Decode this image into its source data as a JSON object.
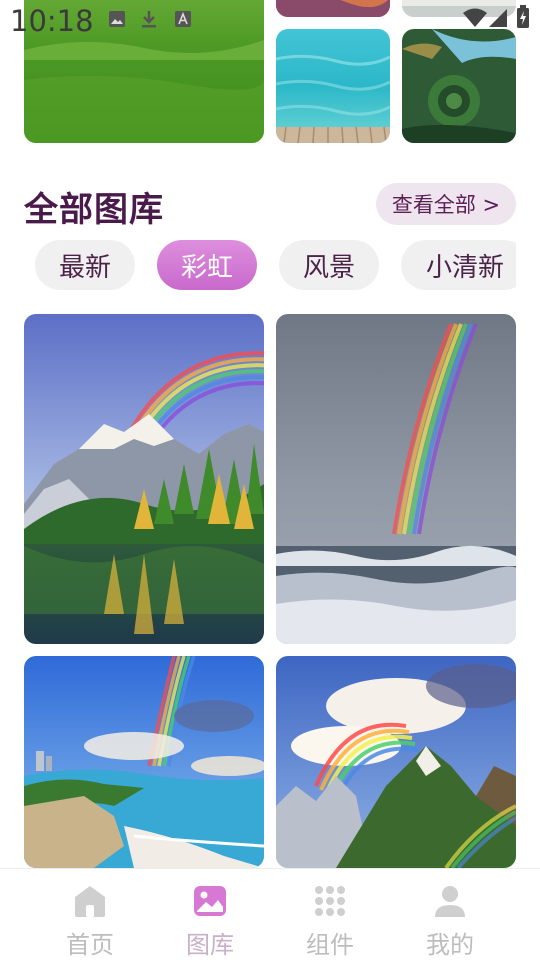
{
  "status_bar": {
    "time": "10:18",
    "icons": [
      "gallery-icon",
      "download-icon",
      "a-icon",
      "wifi-icon",
      "signal-icon",
      "battery-icon"
    ]
  },
  "gallery": {
    "title": "全部图库",
    "view_all_label": "查看全部 >",
    "categories": [
      {
        "label": "最新",
        "active": false
      },
      {
        "label": "彩虹",
        "active": true
      },
      {
        "label": "风景",
        "active": false
      },
      {
        "label": "小清新",
        "active": false
      }
    ],
    "images": [
      {
        "name": "rainbow-mountain-lake",
        "description": "Rainbow over snowy mountains and lake"
      },
      {
        "name": "rainbow-ocean-waves",
        "description": "Rainbow over stormy sea"
      },
      {
        "name": "rainbow-coast-cliffs",
        "description": "Rainbow over coastal cliffs and beach"
      },
      {
        "name": "rainbow-mountain-clouds",
        "description": "Rainbow over mountain peaks and clouds"
      }
    ]
  },
  "bottom_nav": {
    "items": [
      {
        "label": "首页",
        "icon": "home-icon",
        "active": false
      },
      {
        "label": "图库",
        "icon": "gallery-icon",
        "active": true
      },
      {
        "label": "组件",
        "icon": "grid-icon",
        "active": false
      },
      {
        "label": "我的",
        "icon": "user-icon",
        "active": false
      }
    ]
  },
  "colors": {
    "accent": "#c869cc",
    "title": "#4a1a4a",
    "chip_bg": "#f1f0f1",
    "nav_inactive": "#bdbdbd"
  }
}
